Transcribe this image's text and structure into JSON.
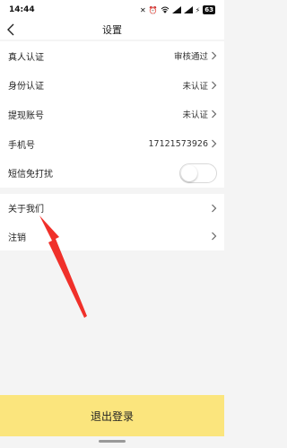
{
  "status_bar": {
    "time": "14:44",
    "battery": "63",
    "icons": [
      "notification-icon",
      "alarm-icon",
      "wifi-icon",
      "signal-icon",
      "signal-icon",
      "charging-icon",
      "battery-icon"
    ]
  },
  "header": {
    "title": "设置",
    "back_icon": "chevron-left-icon"
  },
  "settings": {
    "rows": [
      {
        "label": "真人认证",
        "value": "审核通过",
        "has_chevron": true
      },
      {
        "label": "身份认证",
        "value": "未认证",
        "has_chevron": true
      },
      {
        "label": "提现账号",
        "value": "未认证",
        "has_chevron": true
      },
      {
        "label": "手机号",
        "value": "17121573926",
        "has_chevron": true
      },
      {
        "label": "短信免打扰",
        "toggle": "off"
      }
    ],
    "more_rows": [
      {
        "label": "关于我们",
        "has_chevron": true
      },
      {
        "label": "注销",
        "has_chevron": true
      }
    ]
  },
  "footer": {
    "logout_label": "退出登录",
    "logout_color": "#fbe57d"
  },
  "annotation": {
    "arrow_color": "#f0302a",
    "points_to": "注销"
  }
}
